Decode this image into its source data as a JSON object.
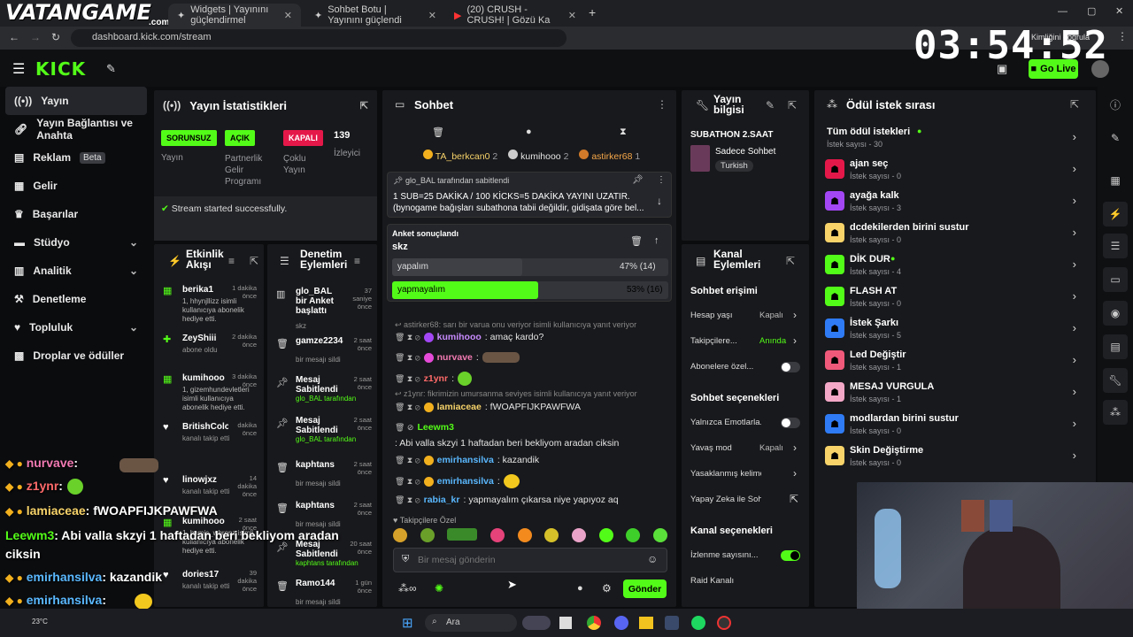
{
  "browser": {
    "brand": "VATANGAME",
    "brand_sub": ".com",
    "tabs": [
      {
        "label": "Widgets | Yayınını güçlendirmel"
      },
      {
        "label": "Sohbet Botu | Yayınını güçlendi"
      },
      {
        "label": "(20) CRUSH - CRUSH! | Gözü Ka"
      }
    ],
    "url": "dashboard.kick.com/stream",
    "profile_label": "Kimliğini doğrula"
  },
  "clock": "03:54:52",
  "header": {
    "logo": "KICK",
    "go_live": "Go Live"
  },
  "sidebar": {
    "items": [
      {
        "label": "Yayın",
        "icon": "broadcast-icon"
      },
      {
        "label": "Yayın Bağlantısı ve Anahta",
        "icon": "link-icon"
      },
      {
        "label": "Reklam",
        "badge": "Beta",
        "icon": "ad-icon"
      },
      {
        "label": "Gelir",
        "icon": "wallet-icon"
      },
      {
        "label": "Başarılar",
        "icon": "trophy-icon"
      },
      {
        "label": "Stüdyo",
        "icon": "studio-icon"
      },
      {
        "label": "Analitik",
        "icon": "chart-icon"
      },
      {
        "label": "Denetleme",
        "icon": "hammer-icon"
      },
      {
        "label": "Topluluk",
        "icon": "community-icon"
      },
      {
        "label": "Droplar ve ödüller",
        "icon": "gift-icon"
      }
    ]
  },
  "stats": {
    "title": "Yayın İstatistikleri",
    "cells": [
      {
        "pill": "SORUNSUZ",
        "label": "Yayın"
      },
      {
        "pill": "AÇIK",
        "label": "Partnerlik Gelir Programı"
      },
      {
        "pill": "KAPALI",
        "label": "Çoklu Yayın"
      },
      {
        "value": "139",
        "label": "İzleyici"
      }
    ],
    "status": "Stream started successfully."
  },
  "activity": {
    "title": "Etkinlik Akışı",
    "items": [
      {
        "name": "berika1",
        "time": "1 dakika önce",
        "detail": "1, hhynjllizz isimli kullanıcıya abonelik hediye etti."
      },
      {
        "name": "ZeyShiii",
        "time": "2 dakika önce",
        "detail": "abone oldu"
      },
      {
        "name": "kumihooo",
        "time": "3 dakika önce",
        "detail": "1, gizemhundevletleri isimli kullanıcıya abonelik hediye etti."
      },
      {
        "name": "BritishColony",
        "time": "dakika önce",
        "detail": "kanalı takip etti"
      },
      {
        "name": "linowjxz",
        "time": "14 dakika önce",
        "detail": "kanalı takip etti"
      },
      {
        "name": "kumihooo",
        "time": "2 saat önce",
        "detail": "1, hamis_wbronz isimli kullanıcıya abonelik hediye etti."
      },
      {
        "name": "dories17",
        "time": "39 dakika önce",
        "detail": "kanalı takip etti"
      }
    ]
  },
  "moderation": {
    "title": "Denetim Eylemleri",
    "items": [
      {
        "title": "glo_BAL bir Anket başlattı",
        "time": "37 saniye önce",
        "detail": "skz"
      },
      {
        "title": "gamze2234",
        "time": "2 saat önce",
        "detail": "bir mesajı sildi"
      },
      {
        "title": "Mesaj Sabitlendi",
        "time": "2 saat önce",
        "detail": "glo_BAL tarafından"
      },
      {
        "title": "Mesaj Sabitlendi",
        "time": "2 saat önce",
        "detail": "glo_BAL tarafından"
      },
      {
        "title": "kaphtans",
        "time": "2 saat önce",
        "detail": "bir mesajı sildi"
      },
      {
        "title": "kaphtans",
        "time": "2 saat önce",
        "detail": "bir mesajı sildi"
      },
      {
        "title": "Mesaj Sabitlendi",
        "time": "20 saat önce",
        "detail": "kaphtans tarafından"
      },
      {
        "title": "Ramo144",
        "time": "1 gün önce",
        "detail": "bir mesajı sildi"
      }
    ]
  },
  "chat": {
    "title": "Sohbet",
    "gifters": [
      {
        "rank": "1",
        "name": "TA_berkcan0",
        "count": "2"
      },
      {
        "rank": "2",
        "name": "kumihooo",
        "count": "2"
      },
      {
        "rank": "3",
        "name": "astirker68",
        "count": "1"
      }
    ],
    "pinned": {
      "by": "glo_BAL tarafından sabitlendi",
      "text": "1 SUB=25 DAKİKA / 100 KİCKS=5 DAKİKA YAYINI UZATIR. (bynogame bağışları subathona tabii değildir, gidişata göre bel..."
    },
    "poll": {
      "label": "Anket sonuçlandı",
      "question": "skz",
      "options": [
        {
          "text": "yapalım",
          "pct_label": "47% (14)",
          "pct": 47
        },
        {
          "text": "yapmayalım",
          "pct_label": "53% (16)",
          "pct": 53
        }
      ]
    },
    "messages": [
      {
        "reply": "astirker68: sarı bir varua onu veriyor isimli kullanıcıya yanıt veriyor"
      },
      {
        "user": "kumihooo",
        "text": ": amaç kardo?"
      },
      {
        "user": "nurvave",
        "text": ":"
      },
      {
        "user": "z1ynr",
        "text": ":"
      },
      {
        "reply": "z1ynr: fikrimizin umursanma seviyes isimli kullanıcıya yanıt veriyor"
      },
      {
        "user": "lamiaceae",
        "text": ": fWOAPFIJKPAWFWA"
      },
      {
        "user": "Leewm3",
        "text": ": Abi valla skzyi 1 haftadan beri bekliyom aradan ciksin"
      },
      {
        "user": "emirhansilva",
        "text": ": kazandik"
      },
      {
        "user": "emirhansilva",
        "text": ":"
      },
      {
        "user": "rabia_kr",
        "text": ": yapmayalım çıkarsa niye yapıyoz aq"
      }
    ],
    "emote_label": "Takipçilere Özel",
    "input_placeholder": "Bir mesaj gönderin",
    "send": "Gönder"
  },
  "stream_info": {
    "title": "Yayın bilgisi",
    "stream_title": "SUBATHON 2.SAAT",
    "category": "Sadece Sohbet",
    "tag": "Turkish"
  },
  "channel": {
    "title": "Kanal Eylemleri",
    "sections": [
      {
        "header": "Sohbet erişimi"
      },
      {
        "label": "Hesap yaşı",
        "value": "Kapalı"
      },
      {
        "label": "Takipçilere...",
        "value": "Anında"
      },
      {
        "label": "Abonelere özel...",
        "toggle": "off"
      },
      {
        "header": "Sohbet seçenekleri"
      },
      {
        "label": "Yalnızca Emotlarla...",
        "toggle": "off"
      },
      {
        "label": "Yavaş mod",
        "value": "Kapalı"
      },
      {
        "label": "Yasaklanmış kelimeler",
        "value": ""
      },
      {
        "label": "Yapay Zeka ile Sohbe...",
        "value": ""
      },
      {
        "header": "Kanal seçenekleri"
      },
      {
        "label": "İzlenme sayısını...",
        "toggle": "on"
      },
      {
        "label": "Raid Kanalı",
        "value": ""
      }
    ]
  },
  "rewards": {
    "title": "Ödül istek sırası",
    "all": {
      "label": "Tüm ödül istekleri",
      "sub": "İstek sayısı - 30"
    },
    "items": [
      {
        "label": "ajan seç",
        "sub": "İstek sayısı - 0",
        "color": "#e5184a"
      },
      {
        "label": "ayağa kalk",
        "sub": "İstek sayısı - 3",
        "color": "#a347f5"
      },
      {
        "label": "dcdekilerden birini sustur",
        "sub": "İstek sayısı - 0",
        "color": "#f7d36a"
      },
      {
        "label": "DİK DUR",
        "sub": "İstek sayısı - 4",
        "color": "#53fc18"
      },
      {
        "label": "FLASH AT",
        "sub": "İstek sayısı - 0",
        "color": "#53fc18"
      },
      {
        "label": "İstek Şarkı",
        "sub": "İstek sayısı - 5",
        "color": "#2f7bf5"
      },
      {
        "label": "Led Değiştir",
        "sub": "İstek sayısı - 1",
        "color": "#f0597a"
      },
      {
        "label": "MESAJ VURGULA",
        "sub": "İstek sayısı - 1",
        "color": "#f4a8c8"
      },
      {
        "label": "modlardan birini sustur",
        "sub": "İstek sayısı - 0",
        "color": "#2f7bf5"
      },
      {
        "label": "Skin Değiştirme",
        "sub": "İstek sayısı - 0",
        "color": "#f7d36a"
      }
    ]
  },
  "overlay": {
    "lines": [
      {
        "user": "nurvave",
        "text": ":"
      },
      {
        "user": "z1ynr",
        "text": ":"
      },
      {
        "user": "lamiaceae",
        "text": ": fWOAPFIJKPAWFWA"
      },
      {
        "user": "Leewm3",
        "text": ": Abi valla skzyi 1 haftadan beri bekliyom aradan"
      },
      {
        "user": "",
        "text": "ciksin"
      },
      {
        "user": "emirhansilva",
        "text": ": kazandik"
      },
      {
        "user": "emirhansilva",
        "text": ":"
      },
      {
        "user": "rabia_kr",
        "text": ": yapmayalım çıkarsa niye yapıyoz aq"
      }
    ]
  },
  "taskbar": {
    "search": "Ara",
    "temp": "23°C"
  }
}
